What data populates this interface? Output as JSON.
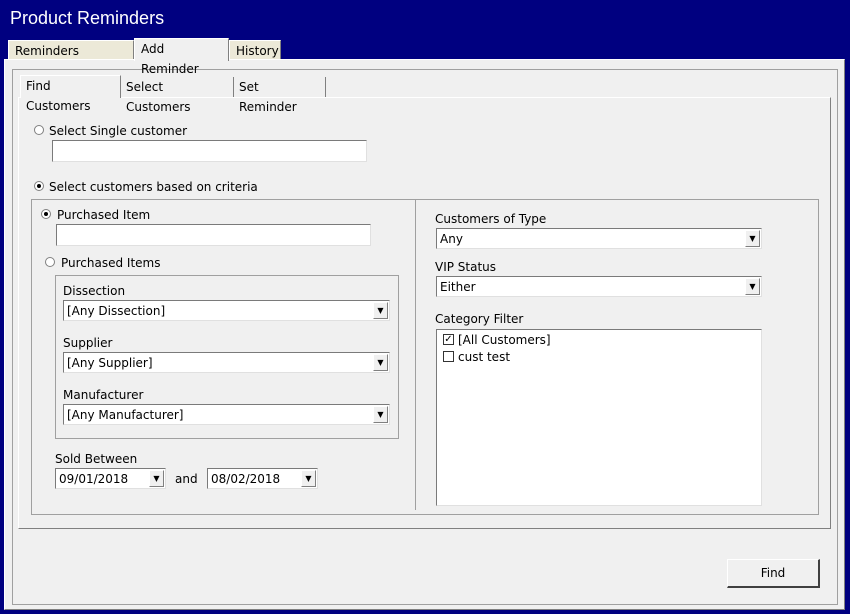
{
  "window": {
    "title": "Product Reminders"
  },
  "outer_tabs": [
    {
      "label": "Reminders Pending"
    },
    {
      "label": "Add Reminder"
    },
    {
      "label": "History"
    }
  ],
  "inner_tabs": [
    {
      "label": "Find Customers"
    },
    {
      "label": "Select Customers"
    },
    {
      "label": "Set Reminder"
    }
  ],
  "single_customer": {
    "label": "Select Single customer",
    "value": ""
  },
  "criteria": {
    "label": "Select customers based on criteria",
    "purchased_item": {
      "label": "Purchased Item",
      "value": ""
    },
    "purchased_items": {
      "label": "Purchased Items",
      "dissection": {
        "label": "Dissection",
        "value": "[Any Dissection]"
      },
      "supplier": {
        "label": "Supplier",
        "value": "[Any Supplier]"
      },
      "manufacturer": {
        "label": "Manufacturer",
        "value": "[Any Manufacturer]"
      }
    },
    "sold_between": {
      "label": "Sold Between",
      "from": "09/01/2018",
      "and_label": "and",
      "to": "08/02/2018"
    },
    "customers_of_type": {
      "label": "Customers of Type",
      "value": "Any"
    },
    "vip_status": {
      "label": "VIP Status",
      "value": "Either"
    },
    "category_filter": {
      "label": "Category Filter",
      "items": [
        {
          "label": "[All Customers]",
          "checked": true
        },
        {
          "label": "cust test",
          "checked": false
        }
      ]
    }
  },
  "find_button": {
    "label": "Find"
  },
  "icons": {
    "dropdown": "▼",
    "check": "✓"
  }
}
